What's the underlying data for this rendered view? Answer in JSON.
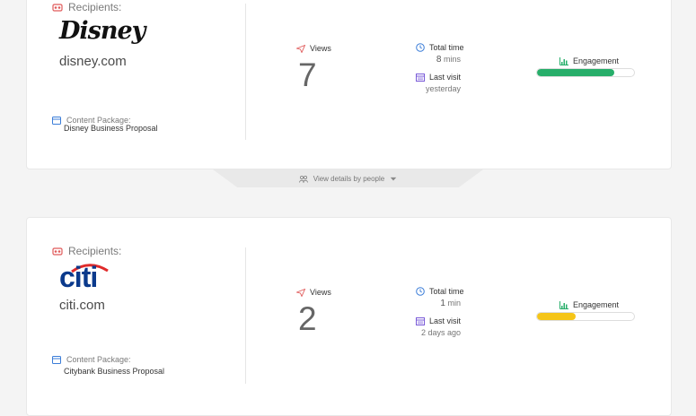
{
  "cards": [
    {
      "recipients_label": "Recipients:",
      "logo_text": "Disney",
      "domain": "disney.com",
      "package_label": "Content Package:",
      "package_name": "Disney Business Proposal",
      "views_label": "Views",
      "views": "7",
      "total_time_label": "Total time",
      "total_time_num": "8",
      "total_time_unit": "mins",
      "last_visit_label": "Last visit",
      "last_visit": "yesterday",
      "engagement_label": "Engagement",
      "engagement": 0.8,
      "engagement_color": "#27ae6a"
    },
    {
      "recipients_label": "Recipients:",
      "logo_text": "citi",
      "domain": "citi.com",
      "package_label": "Content Package:",
      "package_name": "Citybank Business Proposal",
      "views_label": "Views",
      "views": "2",
      "total_time_label": "Total time",
      "total_time_num": "1",
      "total_time_unit": "min",
      "last_visit_label": "Last visit",
      "last_visit": "2 days ago",
      "engagement_label": "Engagement",
      "engagement": 0.4,
      "engagement_color": "#f5c518"
    }
  ],
  "details_toggle": {
    "label": "View details by people"
  },
  "colors": {
    "recipients_icon": "#e05a5a",
    "views_icon": "#e05a5a",
    "total_time_icon": "#3b7dd8",
    "last_visit_icon": "#7a5bd8",
    "engagement_icon": "#27ae6a",
    "package_icon": "#3b7dd8",
    "citi_blue": "#0b3a8c",
    "citi_red": "#e02a2a"
  }
}
